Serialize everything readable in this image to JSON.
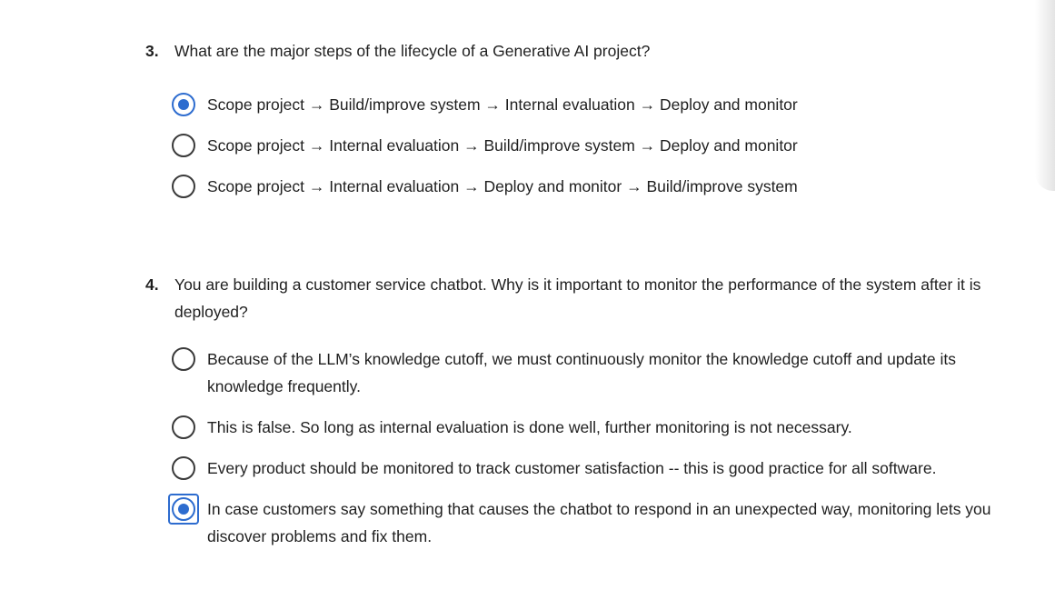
{
  "questions": [
    {
      "number": "3.",
      "text": "What are the major steps of the lifecycle of a Generative AI project?",
      "options": [
        {
          "label": "Scope project → Build/improve system → Internal evaluation → Deploy and monitor",
          "selected": true
        },
        {
          "label": "Scope project → Internal evaluation → Build/improve system → Deploy and monitor",
          "selected": false
        },
        {
          "label": "Scope project → Internal evaluation → Deploy and monitor → Build/improve system",
          "selected": false
        }
      ]
    },
    {
      "number": "4.",
      "text": "You are building a customer service chatbot. Why is it important to monitor the performance of the system after it is deployed?",
      "options": [
        {
          "label": "Because of the LLM’s knowledge cutoff, we must continuously monitor the knowledge cutoff and update its knowledge frequently.",
          "selected": false
        },
        {
          "label": "This is false. So long as internal evaluation is done well, further monitoring is not necessary.",
          "selected": false
        },
        {
          "label": "Every product should be monitored to track customer satisfaction -- this is good practice for all software.",
          "selected": false
        },
        {
          "label": "In case customers say something that causes the chatbot to respond in an unexpected way, monitoring lets you discover problems and fix them.",
          "selected": true
        }
      ]
    }
  ],
  "colors": {
    "accent": "#2d6ccf",
    "text": "#1f1f1f",
    "radio_border": "#3a3a3a"
  }
}
